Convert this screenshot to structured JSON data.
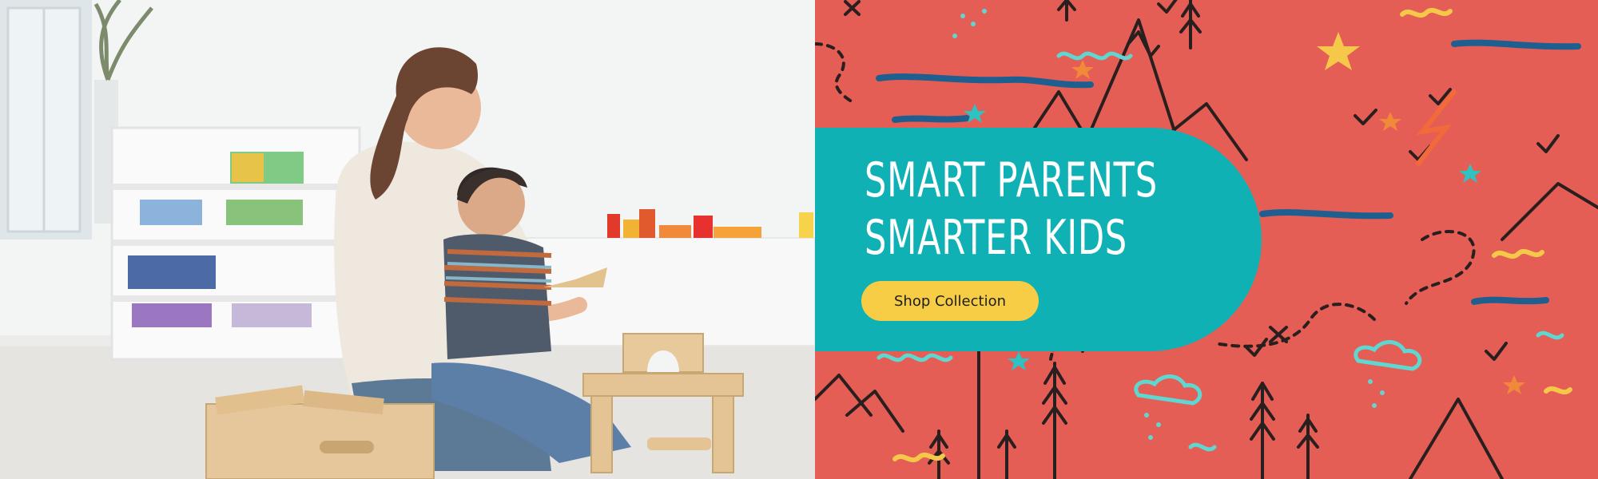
{
  "hero": {
    "headline_line1": "Smart Parents",
    "headline_line2": "Smarter Kids",
    "cta_label": "Shop Collection"
  },
  "colors": {
    "pattern_background": "#e55e56",
    "pill_background": "#0fb1b5",
    "headline_text": "#ffffff",
    "cta_background": "#f7cd46",
    "cta_text": "#1d1d1d",
    "doodle_dark": "#2a1f1f",
    "doodle_blue": "#1f5f8f",
    "doodle_teal": "#5fd7d0",
    "doodle_yellow": "#f6c84a",
    "doodle_orange": "#f08a3a"
  },
  "images": {
    "photo": "mother-and-son-playing-with-wooden-blocks"
  }
}
